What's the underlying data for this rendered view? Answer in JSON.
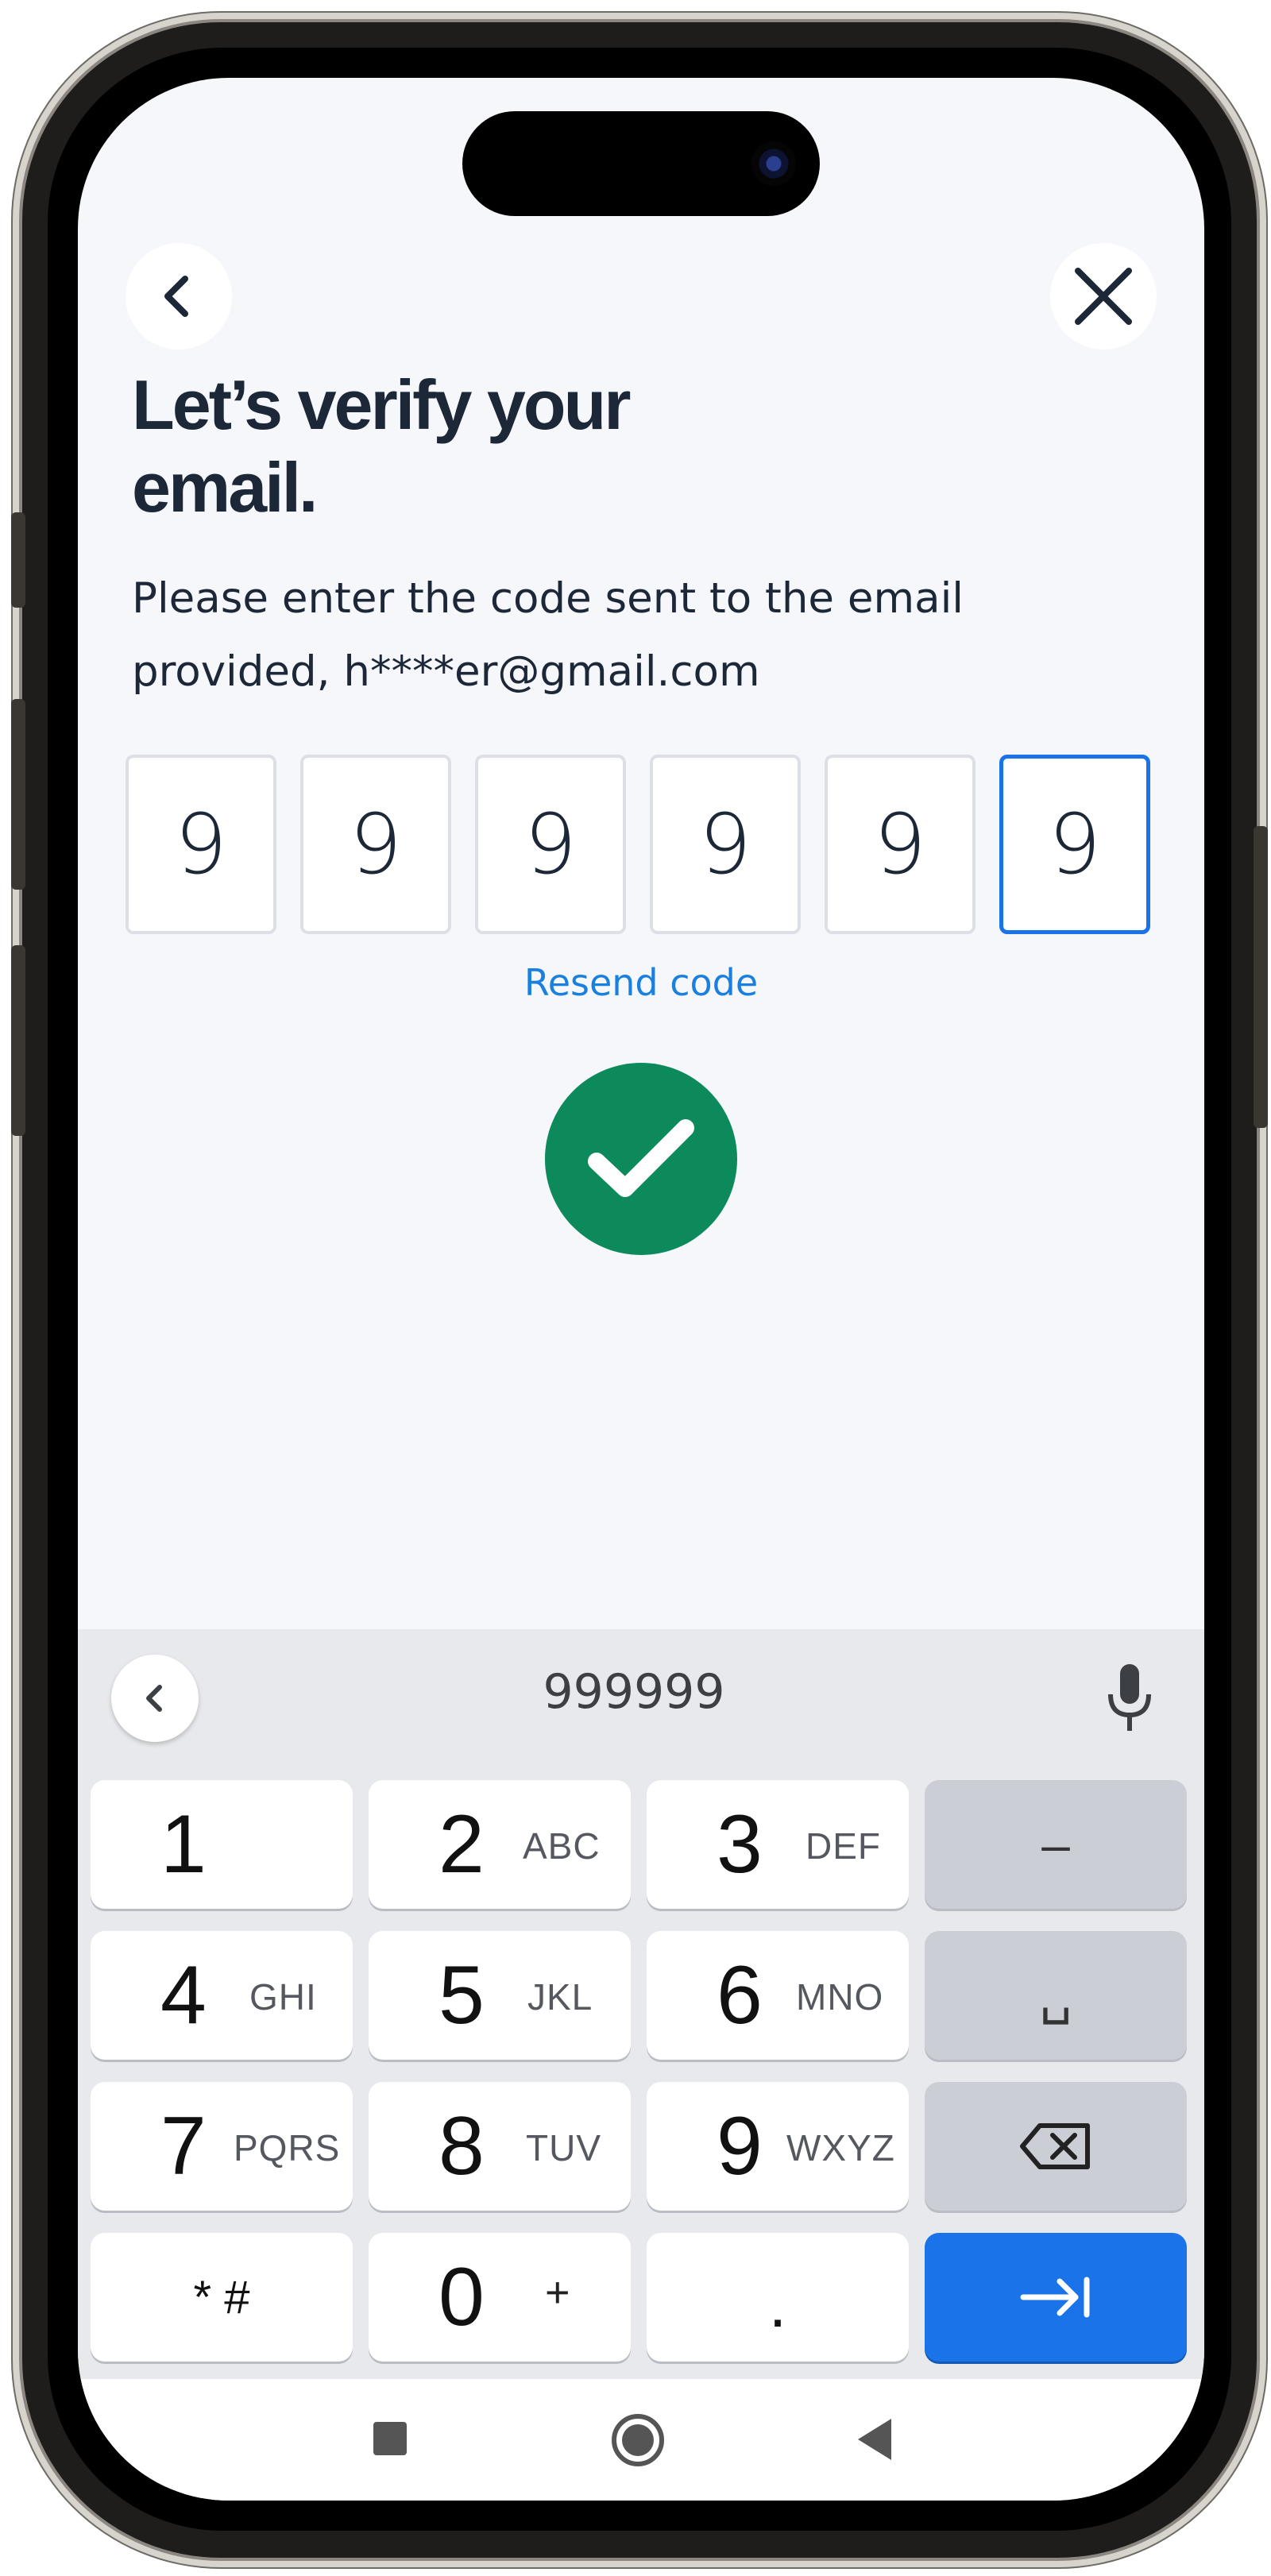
{
  "header": {
    "back_icon": "chevron-left-icon",
    "close_icon": "close-icon",
    "title_line1": "Let’s verify your",
    "title_line2": "email.",
    "subtitle_line1": "Please enter the code sent to the email",
    "subtitle_line2": "provided, h****er@gmail.com"
  },
  "otp": {
    "digits": [
      "9",
      "9",
      "9",
      "9",
      "9",
      "9"
    ],
    "active_index": 5,
    "accent_color": "#1a73e8"
  },
  "resend_label": "Resend code",
  "status": {
    "icon": "checkmark-icon",
    "color": "#0c8a5b"
  },
  "keyboard": {
    "suggestion": "999999",
    "suggest_back_icon": "chevron-left-icon",
    "mic_icon": "microphone-icon",
    "keys": [
      {
        "main": "1",
        "sub": ""
      },
      {
        "main": "2",
        "sub": "ABC"
      },
      {
        "main": "3",
        "sub": "DEF"
      },
      {
        "main": "–",
        "sub": ""
      },
      {
        "main": "4",
        "sub": "GHI"
      },
      {
        "main": "5",
        "sub": "JKL"
      },
      {
        "main": "6",
        "sub": "MNO"
      },
      {
        "main": "␣",
        "sub": ""
      },
      {
        "main": "7",
        "sub": "PQRS"
      },
      {
        "main": "8",
        "sub": "TUV"
      },
      {
        "main": "9",
        "sub": "WXYZ"
      },
      {
        "main": "⌫",
        "sub": ""
      },
      {
        "main": "* #",
        "sub": ""
      },
      {
        "main": "0",
        "sub": "+"
      },
      {
        "main": ".",
        "sub": ""
      },
      {
        "main": "→|",
        "sub": ""
      }
    ],
    "enter_color": "#1a73e8"
  },
  "navbar": {
    "recents_icon": "square-icon",
    "home_icon": "circle-icon",
    "back_icon": "triangle-back-icon"
  }
}
